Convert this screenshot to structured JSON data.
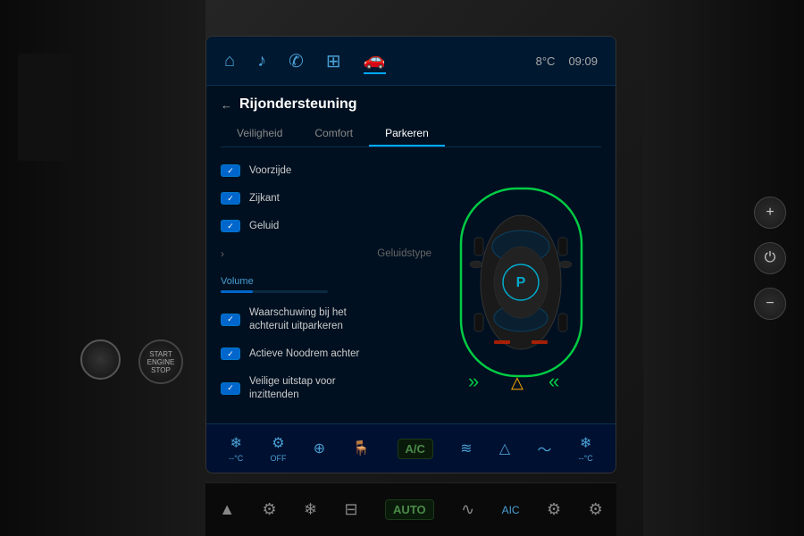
{
  "status": {
    "temperature": "8°C",
    "time": "09:09"
  },
  "nav": {
    "icons": [
      "⌂",
      "♪",
      "✆",
      "⊞",
      "🚗"
    ],
    "active_index": 4
  },
  "page": {
    "back_arrow": "←",
    "title": "Rijondersteuning",
    "tabs": [
      "Veiligheid",
      "Comfort",
      "Parkeren"
    ],
    "active_tab": "Parkeren"
  },
  "settings": [
    {
      "id": "voorzijde",
      "label": "Voorzijde",
      "enabled": true
    },
    {
      "id": "zijkant",
      "label": "Zijkant",
      "enabled": true
    },
    {
      "id": "geluid",
      "label": "Geluid",
      "enabled": true
    },
    {
      "id": "geluidstype",
      "label": "Geluidstype",
      "enabled": false,
      "has_chevron": true
    },
    {
      "id": "volume_label",
      "label": "Volume",
      "is_section": true
    },
    {
      "id": "waarschuwing",
      "label": "Waarschuwing bij het achteruit uitparkeren",
      "enabled": true
    },
    {
      "id": "noodrem",
      "label": "Actieve Noodrem achter",
      "enabled": true
    },
    {
      "id": "uitstap",
      "label": "Veilige uitstap voor inzittenden",
      "enabled": true
    }
  ],
  "volume": {
    "label": "Volume",
    "fill_percent": 30
  },
  "bottom_bar": {
    "items": [
      {
        "symbol": "❄",
        "label": "-- °C"
      },
      {
        "symbol": "⚙",
        "label": "OFF"
      },
      {
        "symbol": "⊕",
        "label": ""
      },
      {
        "symbol": "🪑",
        "label": ""
      },
      {
        "symbol": "A/C",
        "label": "A/C"
      },
      {
        "symbol": "≋",
        "label": ""
      },
      {
        "symbol": "△",
        "label": ""
      },
      {
        "symbol": "〜",
        "label": ""
      },
      {
        "symbol": "❄",
        "label": "-- °C"
      }
    ]
  },
  "physical_bottom": {
    "items": [
      {
        "symbol": "▲",
        "label": ""
      },
      {
        "symbol": "⚙",
        "label": ""
      },
      {
        "symbol": "❄",
        "label": ""
      },
      {
        "symbol": "⊟",
        "label": ""
      },
      {
        "symbol": "AUTO",
        "label": "AUTO"
      },
      {
        "symbol": "∿",
        "label": ""
      },
      {
        "symbol": "A/C",
        "label": "AIC"
      },
      {
        "symbol": "⚙",
        "label": ""
      },
      {
        "symbol": "⚙",
        "label": ""
      }
    ]
  }
}
